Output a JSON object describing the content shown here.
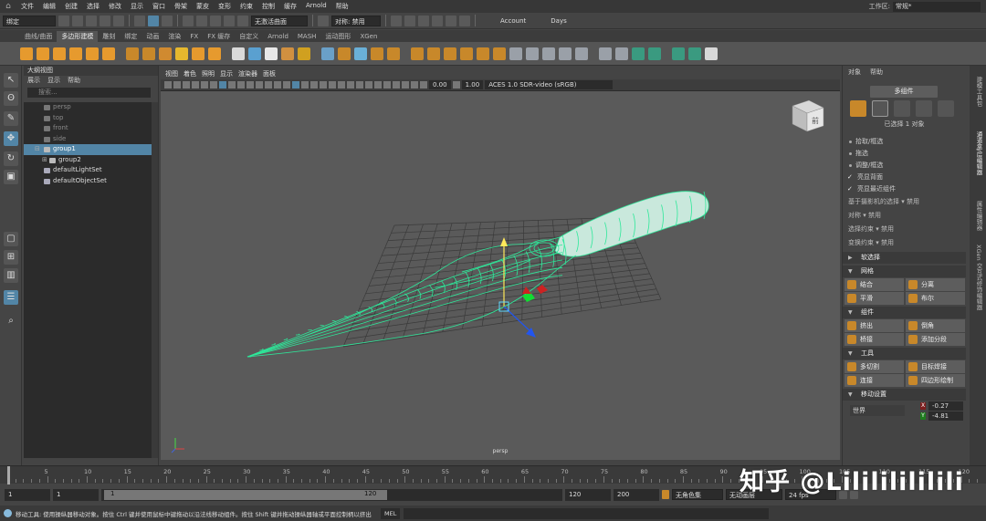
{
  "menubar": {
    "items": [
      "文件",
      "编辑",
      "创建",
      "选择",
      "修改",
      "显示",
      "窗口",
      "骨架",
      "蒙皮",
      "变形",
      "约束",
      "控制",
      "缓存",
      "Arnold",
      "帮助"
    ],
    "workspace_label": "工作区:",
    "workspace_value": "常规*"
  },
  "statusline": {
    "mode_dropdown": "绑定",
    "live_surface": "无激活曲面",
    "symmetry": "对称: 禁用",
    "account": "Account",
    "days": "Days"
  },
  "shelf": {
    "tabs": [
      "曲线/曲面",
      "多边形建模",
      "雕刻",
      "绑定",
      "动画",
      "渲染",
      "FX",
      "FX 缓存",
      "自定义",
      "Arnold",
      "MASH",
      "运动图形",
      "XGen"
    ],
    "active_tab": "多边形建模"
  },
  "outliner": {
    "title": "大纲视图",
    "menus": [
      "展示",
      "显示",
      "帮助"
    ],
    "search_placeholder": "搜索...",
    "items": [
      {
        "label": "persp",
        "type": "camera"
      },
      {
        "label": "top",
        "type": "camera"
      },
      {
        "label": "front",
        "type": "camera"
      },
      {
        "label": "side",
        "type": "camera"
      },
      {
        "label": "group1",
        "type": "group",
        "selected": true
      },
      {
        "label": "group2",
        "type": "group",
        "level": 1
      },
      {
        "label": "defaultLightSet",
        "type": "set"
      },
      {
        "label": "defaultObjectSet",
        "type": "set"
      }
    ]
  },
  "viewport": {
    "menus": [
      "视图",
      "着色",
      "照明",
      "显示",
      "渲染器",
      "面板"
    ],
    "field_a": "0.00",
    "field_b": "1.00",
    "colorspace": "ACES 1.0 SDR-video (sRGB)",
    "camera_label": "persp",
    "viewcube_face": "前"
  },
  "attr": {
    "menus": [
      "对象",
      "帮助"
    ],
    "mode_button": "多组件",
    "selected_count": "已选择 1 对象",
    "select_modes": [
      "拾取/框选",
      "拖选",
      "调整/框选"
    ],
    "checks": [
      "亮显背面",
      "亮显最近组件"
    ],
    "camera_select": "基于摄影机的选择 ▾ 禁用",
    "symmetry": "对称 ▾ 禁用",
    "sel_constraint": "选择约束 ▾ 禁用",
    "transform_constraint": "变换约束 ▾ 禁用",
    "soft_select": "软选择",
    "sections": [
      {
        "title": "网格",
        "buttons": [
          "结合",
          "分离",
          "平滑",
          "布尔"
        ]
      },
      {
        "title": "组件",
        "buttons": [
          "挤出",
          "倒角",
          "桥接",
          "添加分段"
        ]
      },
      {
        "title": "工具",
        "buttons": [
          "多切割",
          "目标焊接",
          "连接",
          "四边形绘制"
        ]
      }
    ],
    "move_settings": "移动设置",
    "world": "世界",
    "x_value": "-0.27",
    "y_value": "-4.81"
  },
  "righttabs": [
    "建模工具包",
    "通道盒/层编辑器",
    "属性编辑器",
    "XGen 交互式修饰编辑器"
  ],
  "timeline": {
    "ticks": [
      "5",
      "10",
      "15",
      "20",
      "25",
      "30",
      "35",
      "40",
      "45",
      "50",
      "55",
      "60",
      "65",
      "70",
      "75",
      "80",
      "85",
      "90",
      "95",
      "100",
      "105",
      "110",
      "115",
      "120"
    ]
  },
  "range": {
    "start": "1",
    "start2": "1",
    "slider_start": "1",
    "slider_end": "120",
    "end": "120",
    "end2": "200",
    "char_set": "无角色集",
    "anim_layer": "无动画层",
    "fps": "24 fps"
  },
  "helpline": {
    "text": "移动工具: 使用操纵器移动对象。按住 Ctrl 键并使用鼠标中键拖动以沿法线移动组件。按住 Shift 键并拖动操纵器轴或平面控制柄以挤出组件或克隆对象。按住 C",
    "mel": "MEL"
  },
  "watermark": "知乎 @Lilililililili",
  "colors": {
    "selection": "#5285a6",
    "wire": "#2ee89a",
    "accent": "#c8882a"
  }
}
